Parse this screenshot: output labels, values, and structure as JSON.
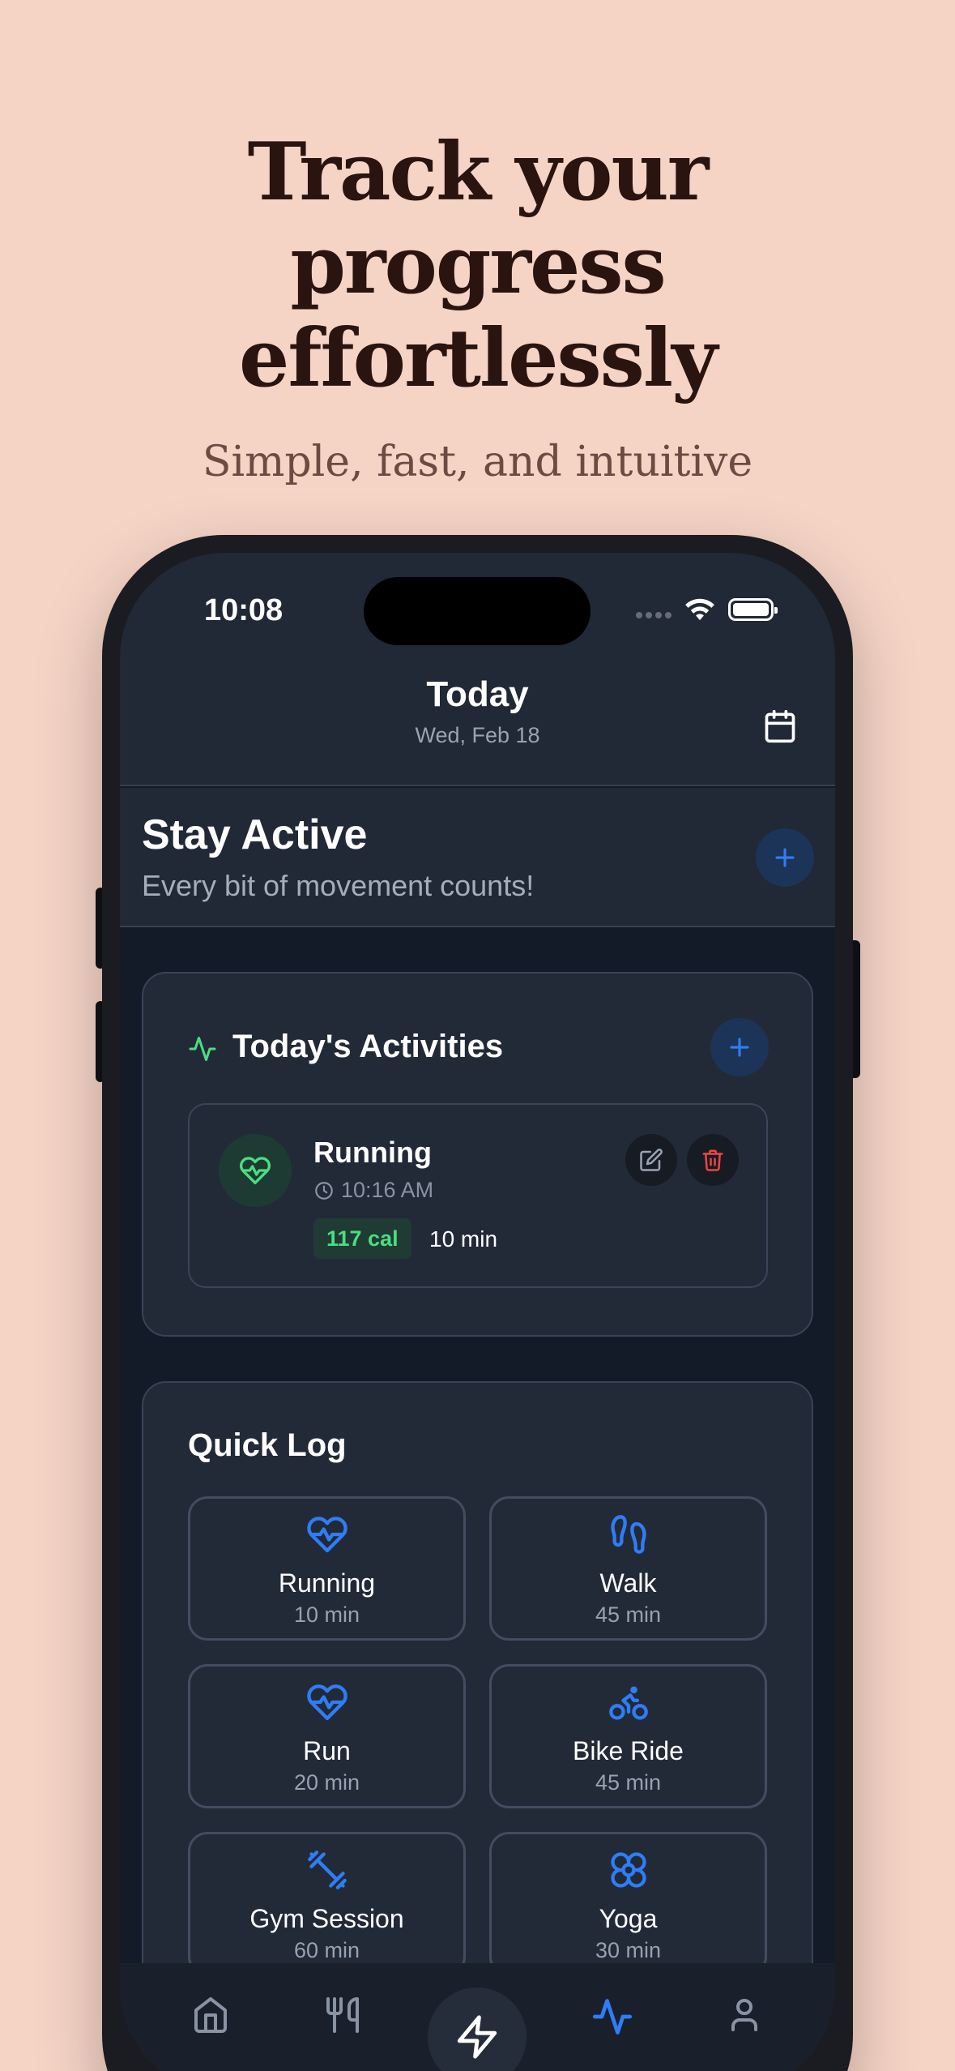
{
  "hero": {
    "title_line1": "Track your",
    "title_line2": "progress",
    "title_line3": "effortlessly",
    "subtitle": "Simple, fast, and intuitive"
  },
  "status_bar": {
    "time": "10:08"
  },
  "header": {
    "title": "Today",
    "date": "Wed, Feb 18"
  },
  "banner": {
    "title": "Stay Active",
    "subtitle": "Every bit of movement counts!"
  },
  "activities": {
    "title": "Today's Activities",
    "items": [
      {
        "name": "Running",
        "time": "10:16 AM",
        "calories": "117 cal",
        "duration": "10 min"
      }
    ]
  },
  "quick_log": {
    "title": "Quick Log",
    "items": [
      {
        "name": "Running",
        "duration": "10 min",
        "icon": "heart-pulse-icon"
      },
      {
        "name": "Walk",
        "duration": "45 min",
        "icon": "footprints-icon"
      },
      {
        "name": "Run",
        "duration": "20 min",
        "icon": "heart-pulse-icon"
      },
      {
        "name": "Bike Ride",
        "duration": "45 min",
        "icon": "bike-icon"
      },
      {
        "name": "Gym Session",
        "duration": "60 min",
        "icon": "dumbbell-icon"
      },
      {
        "name": "Yoga",
        "duration": "30 min",
        "icon": "flower-icon"
      }
    ]
  },
  "tabbar": {
    "tabs": [
      "home-icon",
      "utensils-icon",
      "zap-icon",
      "activity-icon",
      "user-icon"
    ],
    "active": "activity-icon"
  },
  "colors": {
    "background": "#f5d4c6",
    "accent_blue": "#2f7df6",
    "green": "#4ade80",
    "red": "#ef4444",
    "card": "#222a38"
  }
}
